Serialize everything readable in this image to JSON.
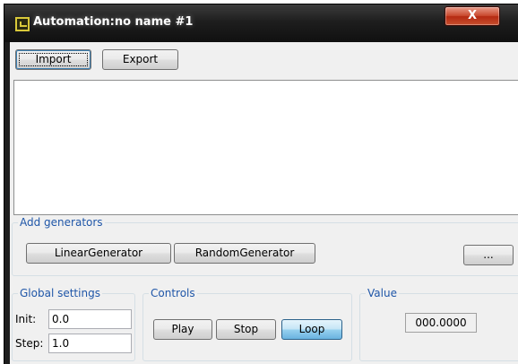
{
  "window": {
    "title": "Automation:no name #1",
    "icon": "app-icon",
    "close_glyph": "X"
  },
  "toolbar": {
    "import_label": "Import",
    "export_label": "Export"
  },
  "generators": {
    "group_label": "Add generators",
    "linear_label": "LinearGenerator",
    "random_label": "RandomGenerator",
    "more_label": "..."
  },
  "global_settings": {
    "group_label": "Global settings",
    "init_label": "Init:",
    "init_value": "0.0",
    "step_label": "Step:",
    "step_value": "1.0"
  },
  "controls": {
    "group_label": "Controls",
    "play_label": "Play",
    "stop_label": "Stop",
    "loop_label": "Loop",
    "loop_active": true
  },
  "value": {
    "group_label": "Value",
    "current": "000.0000"
  },
  "colors": {
    "group_label_blue": "#1f56a8",
    "close_red": "#c9492e",
    "active_button_blue": "#98d1ef"
  }
}
